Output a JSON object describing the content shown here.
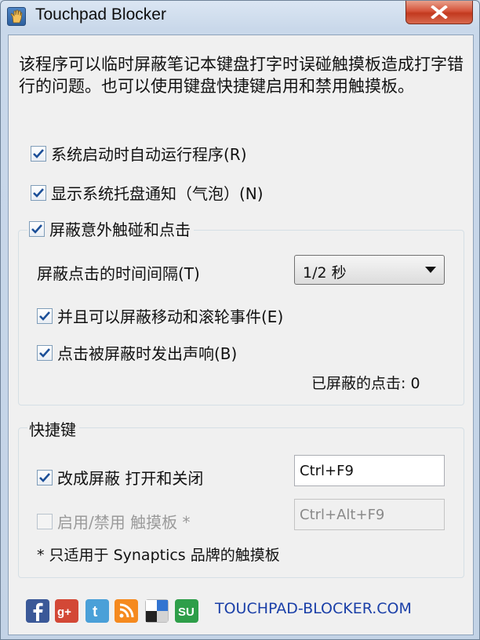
{
  "window": {
    "title": "Touchpad Blocker",
    "close_glyph": "close-icon"
  },
  "description": "该程序可以临时屏蔽笔记本键盘打字时误碰触摸板造成打字错行的问题。也可以使用键盘快捷键启用和禁用触摸板。",
  "options": {
    "autostart": {
      "label": "系统启动时自动运行程序(R)",
      "checked": true
    },
    "tray_notify": {
      "label": "显示系统托盘通知（气泡）(N)",
      "checked": true
    }
  },
  "block_group": {
    "label": "屏蔽意外触碰和点击",
    "checked": true,
    "interval_label": "屏蔽点击的时间间隔(T)",
    "interval_value": "1/2 秒",
    "block_move": {
      "label": "并且可以屏蔽移动和滚轮事件(E)",
      "checked": true
    },
    "beep": {
      "label": "点击被屏蔽时发出声响(B)",
      "checked": true
    },
    "blocked_count_label": "已屏蔽的点击:",
    "blocked_count": "0"
  },
  "hotkeys": {
    "label": "快捷键",
    "toggle_block": {
      "label": "改成屏蔽 打开和关闭",
      "checked": true,
      "value": "Ctrl+F9"
    },
    "toggle_touchpad": {
      "label": "启用/禁用 触摸板 *",
      "checked": false,
      "value": "Ctrl+Alt+F9"
    },
    "note": "* 只适用于 Synaptics 品牌的触摸板"
  },
  "footer": {
    "social": [
      "facebook-icon",
      "google-plus-icon",
      "twitter-icon",
      "rss-icon",
      "delicious-icon",
      "stumbleupon-icon"
    ],
    "site": "TOUCHPAD-BLOCKER.COM"
  },
  "colors": {
    "link": "#1a3fa8",
    "check": "#1c4f98"
  }
}
